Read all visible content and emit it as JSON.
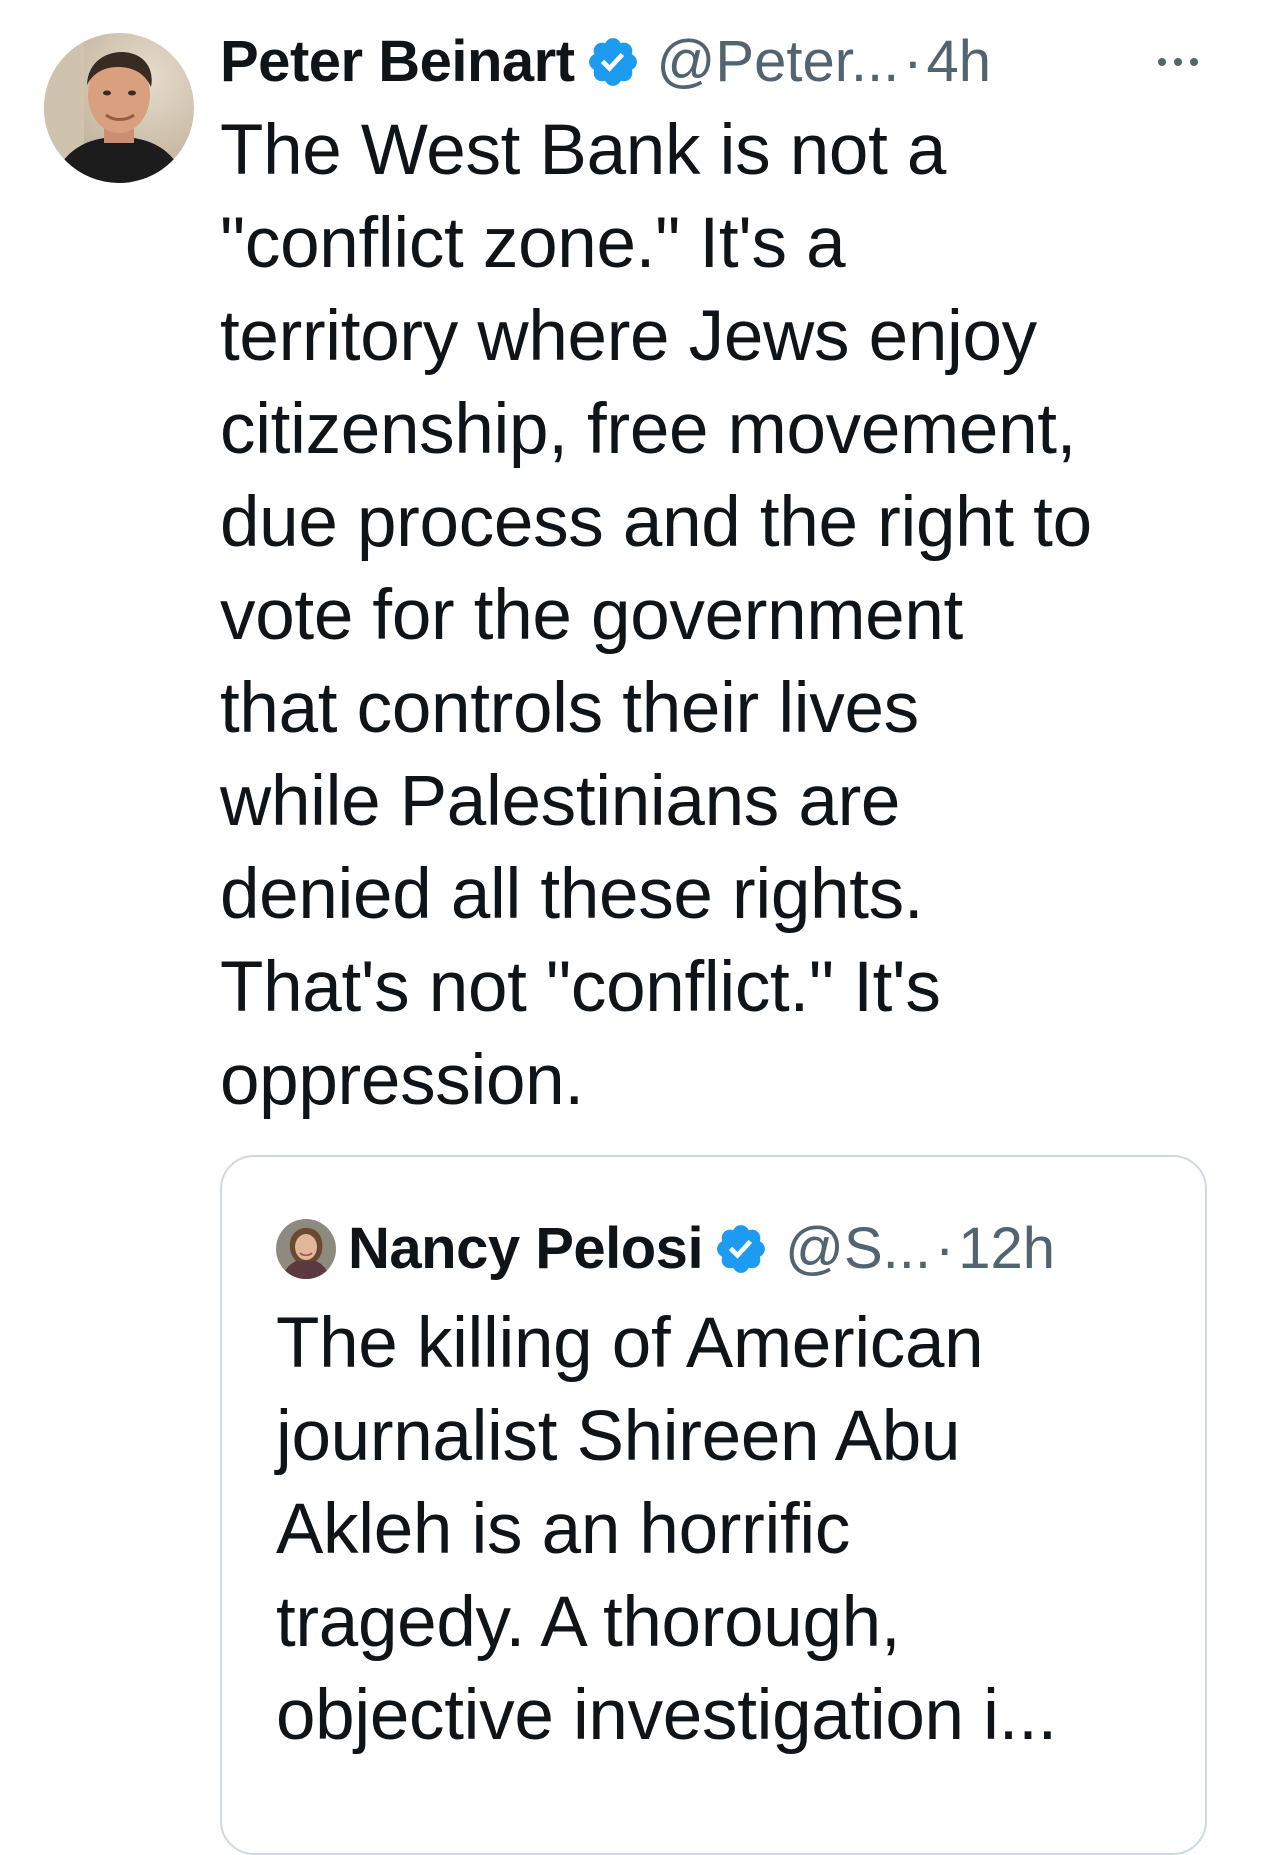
{
  "tweet": {
    "author_name": "Peter Beinart",
    "handle": "@Peter...",
    "separator": "·",
    "time": "4h",
    "verified_icon": "verified-badge-icon",
    "more_icon": "more-options-icon",
    "text": "The West Bank is not a\n\"conflict zone.\" It's a\nterritory where Jews enjoy\ncitizenship, free movement,\ndue process and the right to\nvote for the government\nthat controls their lives\nwhile Palestinians are\ndenied all these rights.\nThat's not \"conflict.\" It's\noppression."
  },
  "quoted_tweet": {
    "author_name": "Nancy Pelosi",
    "handle": "@S...",
    "separator": "·",
    "time": "12h",
    "verified_icon": "verified-badge-icon",
    "text": "The killing of American\njournalist Shireen Abu\nAkleh is an horrific\ntragedy. A thorough,\nobjective investigation i..."
  },
  "colors": {
    "text_primary": "#0f1419",
    "text_secondary": "#536471",
    "verified_blue": "#1d9bf0",
    "border": "#cfd9de",
    "background": "#ffffff"
  }
}
